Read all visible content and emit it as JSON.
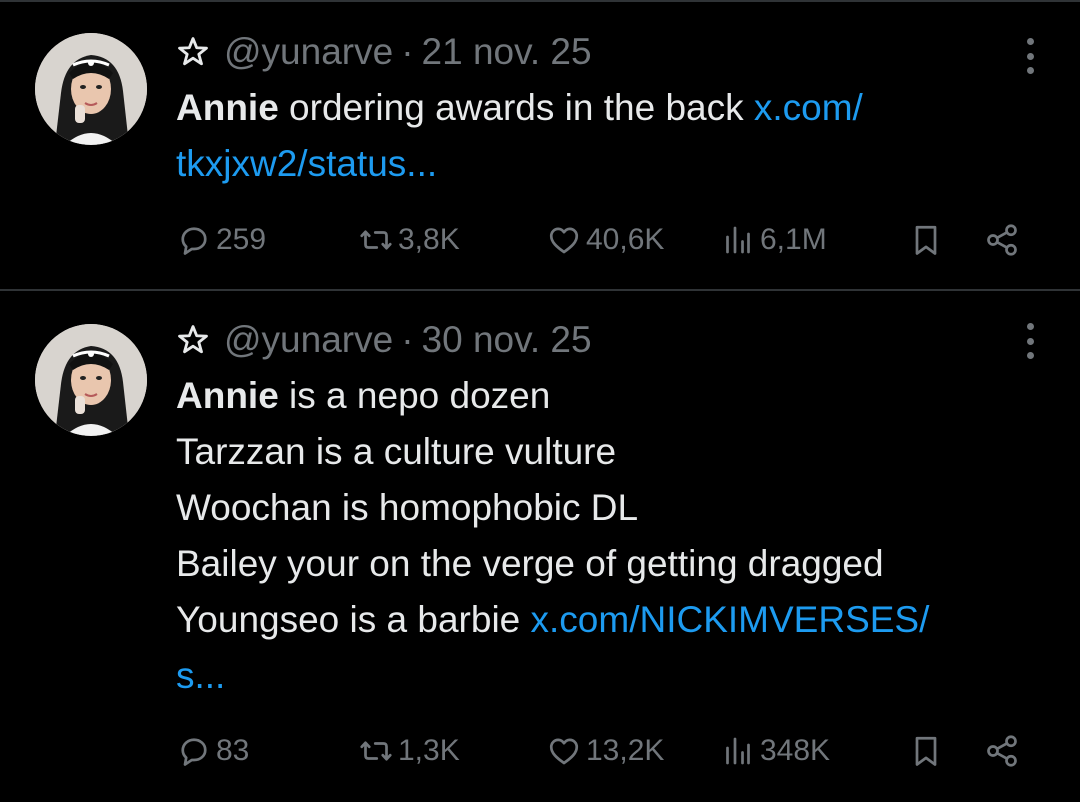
{
  "tweets": [
    {
      "handle": "@yunarve",
      "separator": "·",
      "date": "21 nov. 25",
      "lines": [
        {
          "bold": "Annie",
          "text": " ordering awards in the back ",
          "link": "x.com/"
        },
        {
          "bold": "",
          "text": "",
          "link": "tkxjxw2/status..."
        }
      ],
      "stats": {
        "replies": "259",
        "reposts": "3,8K",
        "likes": "40,6K",
        "views": "6,1M"
      }
    },
    {
      "handle": "@yunarve",
      "separator": "·",
      "date": "30 nov. 25",
      "lines": [
        {
          "bold": "Annie",
          "text": " is a nepo dozen",
          "link": ""
        },
        {
          "bold": "",
          "text": "Tarzzan is a culture vulture",
          "link": ""
        },
        {
          "bold": "",
          "text": "Woochan is homophobic DL",
          "link": ""
        },
        {
          "bold": "",
          "text": "Bailey your on the verge of getting dragged",
          "link": ""
        },
        {
          "bold": "",
          "text": "Youngseo is a barbie ",
          "link": "x.com/NICKIMVERSES/"
        },
        {
          "bold": "",
          "text": "",
          "link": "s..."
        }
      ],
      "stats": {
        "replies": "83",
        "reposts": "1,3K",
        "likes": "13,2K",
        "views": "348K"
      }
    }
  ],
  "icons": {
    "star": "star-outline-icon",
    "more": "more-vertical-icon",
    "reply": "reply-bubble-icon",
    "repost": "repost-arrows-icon",
    "like": "heart-icon",
    "views": "views-bar-chart-icon",
    "bookmark": "bookmark-icon",
    "share": "share-icon"
  },
  "colors": {
    "background": "#000000",
    "text": "#e7e9ea",
    "secondary": "#71767b",
    "link": "#1d9bf0",
    "divider": "#2f3336"
  }
}
